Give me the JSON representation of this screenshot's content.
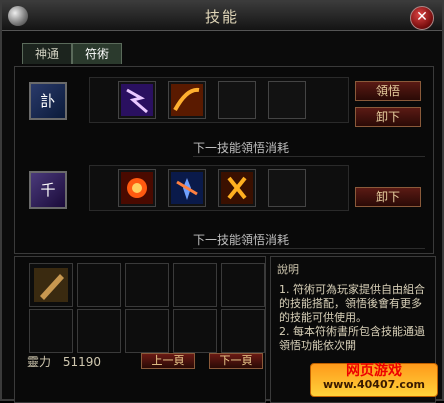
{
  "window": {
    "title": "技能",
    "close_label": "✕"
  },
  "tabs": [
    {
      "label": "神通"
    },
    {
      "label": "符術"
    }
  ],
  "rows": [
    {
      "book_glyph": "訃",
      "cost_label": "下一技能領悟消耗",
      "buttons": [
        "領悟",
        "卸下"
      ]
    },
    {
      "book_glyph": "千",
      "cost_label": "下一技能領悟消耗",
      "buttons": [
        "卸下"
      ]
    }
  ],
  "inventory": {
    "stat_label": "靈力",
    "stat_value": "51190",
    "prev_label": "上一頁",
    "next_label": "下一頁"
  },
  "description": {
    "header": "說明",
    "body": "1. 符術可為玩家提供自由組合的技能搭配，領悟後會有更多的技能可供使用。\n2. 每本符術書所包含技能通過領悟功能依次開",
    "colors": {
      "accent": "#8a5a3a",
      "button": "#5a1a14"
    }
  },
  "watermark": {
    "line1": "网页游戏",
    "line2": "www.40407.com"
  }
}
